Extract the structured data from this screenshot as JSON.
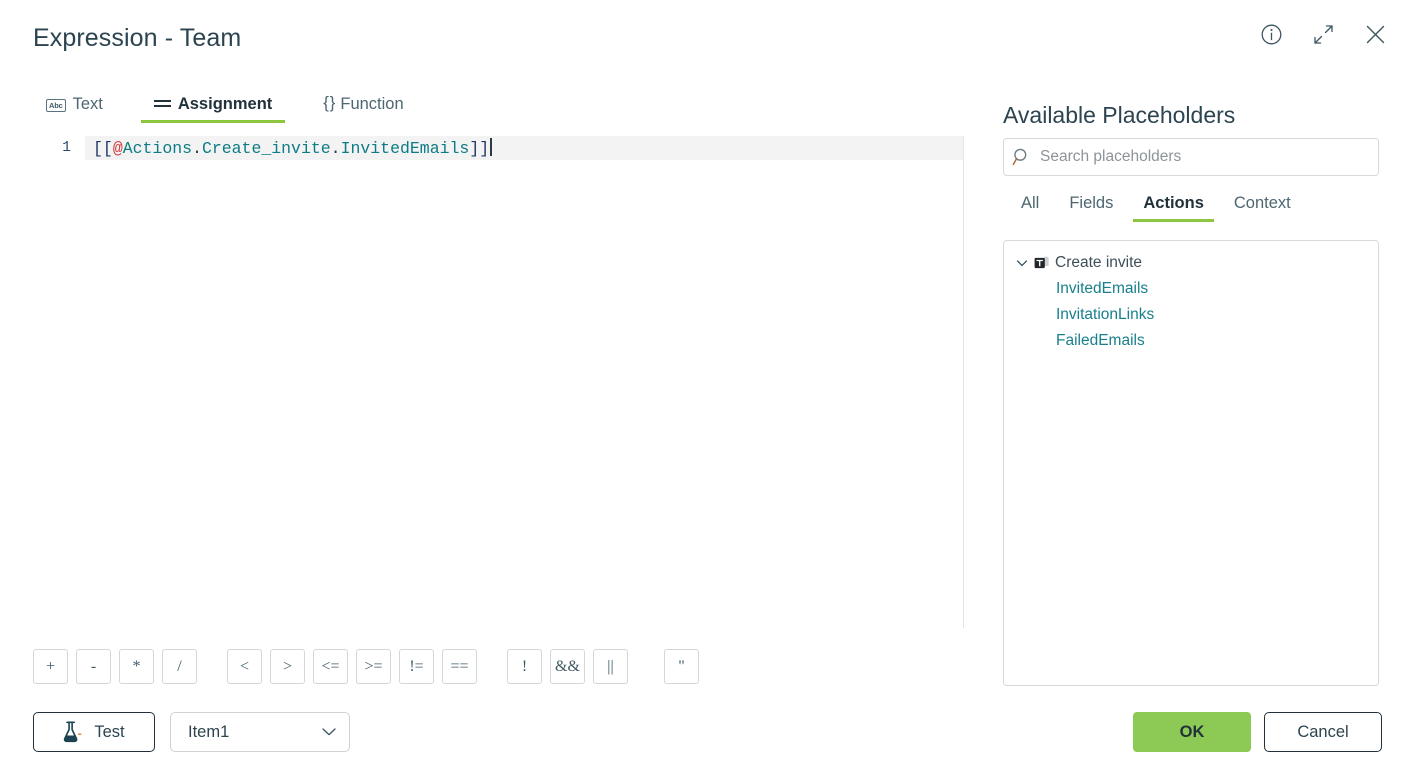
{
  "dialog": {
    "title": "Expression - Team",
    "window_icons": [
      {
        "name": "info-icon",
        "label": "Info"
      },
      {
        "name": "expand-icon",
        "label": "Expand"
      },
      {
        "name": "close-icon",
        "label": "Close"
      }
    ]
  },
  "editor_tabs": [
    {
      "label": "Text",
      "icon": "abc-icon",
      "icon_text": "Abc",
      "active": false
    },
    {
      "label": "Assignment",
      "icon": "assignment-icon",
      "active": true
    },
    {
      "label": "Function",
      "icon": "braces-icon",
      "icon_text": "{ }",
      "active": false
    }
  ],
  "editor": {
    "line_number": "1",
    "tokens": [
      {
        "text": "[[",
        "type": "bracket"
      },
      {
        "text": "@",
        "type": "at"
      },
      {
        "text": "Actions",
        "type": "ident"
      },
      {
        "text": ".",
        "type": "dot"
      },
      {
        "text": "Create_invite",
        "type": "ident"
      },
      {
        "text": ".",
        "type": "dot"
      },
      {
        "text": "InvitedEmails",
        "type": "ident"
      },
      {
        "text": "]]",
        "type": "bracket"
      }
    ],
    "full_text": "[[@Actions.Create_invite.InvitedEmails]]"
  },
  "operators": {
    "arithmetic": [
      "+",
      "-",
      "*",
      "/"
    ],
    "comparison": [
      "<",
      ">",
      "<=",
      ">=",
      "!=",
      "=="
    ],
    "logical": [
      "!",
      "&&",
      "||"
    ],
    "quote": [
      "\""
    ]
  },
  "bottom_left": {
    "test_label": "Test",
    "test_icon": "flask-icon",
    "item_select_value": "Item1",
    "item_select_icon": "chevron-down-icon"
  },
  "placeholders_panel": {
    "title": "Available Placeholders",
    "search": {
      "placeholder": "Search placeholders",
      "value": "",
      "icon": "search-icon"
    },
    "tabs": [
      {
        "label": "All",
        "active": false
      },
      {
        "label": "Fields",
        "active": false
      },
      {
        "label": "Actions",
        "active": true
      },
      {
        "label": "Context",
        "active": false
      }
    ],
    "tree": {
      "node": {
        "label": "Create invite",
        "icon": "teams-icon",
        "expanded": true,
        "chevron": "chevron-down-icon"
      },
      "children": [
        {
          "label": "InvitedEmails"
        },
        {
          "label": "InvitationLinks"
        },
        {
          "label": "FailedEmails"
        }
      ]
    }
  },
  "footer": {
    "ok_label": "OK",
    "cancel_label": "Cancel"
  },
  "colors": {
    "accent_green": "#8dc63f",
    "ok_green": "#8dc955",
    "link_teal": "#18808c",
    "text_dark": "#2c4450",
    "token_at_red": "#d1393c",
    "token_bracket_navy": "#1f3864"
  }
}
